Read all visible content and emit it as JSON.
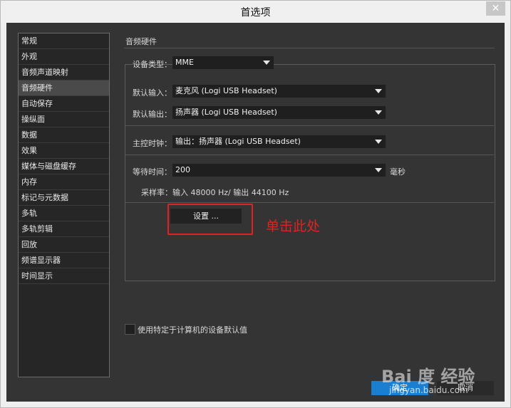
{
  "window": {
    "title": "首选项",
    "close_glyph": "✕"
  },
  "sidebar": {
    "items": [
      {
        "label": "常规"
      },
      {
        "label": "外观"
      },
      {
        "label": "音频声道映射"
      },
      {
        "label": "音频硬件",
        "active": true
      },
      {
        "label": "自动保存"
      },
      {
        "label": "操纵面"
      },
      {
        "label": "数据"
      },
      {
        "label": "效果"
      },
      {
        "label": "媒体与磁盘缓存"
      },
      {
        "label": "内存"
      },
      {
        "label": "标记与元数据"
      },
      {
        "label": "多轨"
      },
      {
        "label": "多轨剪辑"
      },
      {
        "label": "回放"
      },
      {
        "label": "频谱显示器"
      },
      {
        "label": "时间显示"
      }
    ]
  },
  "panel": {
    "section_title": "音频硬件",
    "device_type": {
      "label": "设备类型：",
      "value": "MME"
    },
    "default_input": {
      "label": "默认输入：",
      "value": "麦克风 (Logi USB Headset)"
    },
    "default_output": {
      "label": "默认输出：",
      "value": "扬声器 (Logi USB Headset)"
    },
    "master_clock": {
      "label": "主控时钟：",
      "value": "输出：扬声器 (Logi USB Headset)"
    },
    "latency": {
      "label": "等待时间：",
      "value": "200",
      "unit": "毫秒"
    },
    "sample_rate": "采样率：输入 48000 Hz/ 输出 44100 Hz",
    "settings_button": "设置 ...",
    "annotation": "单击此处",
    "checkbox_label": "使用特定于计算机的设备默认值"
  },
  "footer": {
    "ok_label": "确定",
    "cancel_label": "取消"
  },
  "watermark": {
    "logo": "Bai 度 经验",
    "url": "jingyan.baidu.com"
  },
  "colors": {
    "annotation": "#e02222",
    "ok_button": "#1a7fd1"
  }
}
